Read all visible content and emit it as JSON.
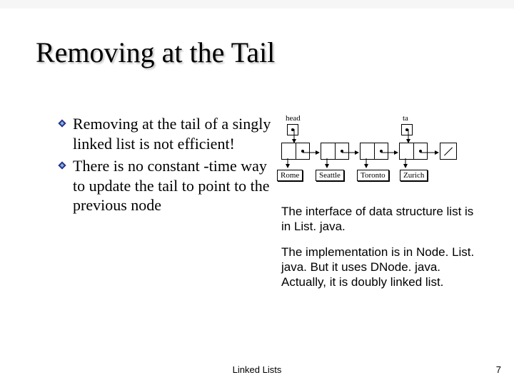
{
  "title": "Removing at the Tail",
  "bullets": [
    "Removing at the tail of a singly linked list is not efficient!",
    "There is no constant -time way to update the tail to point to the previous node"
  ],
  "diagram": {
    "head_label": "head",
    "tail_label": "ta",
    "cities": [
      "Rome",
      "Seattle",
      "Toronto",
      "Zurich"
    ]
  },
  "right_text": [
    "The interface of data structure list is in List. java.",
    "The implementation is in Node. List. java. But it uses DNode. java. Actually, it is doubly linked list."
  ],
  "footer": {
    "center": "Linked Lists",
    "page": "7"
  }
}
